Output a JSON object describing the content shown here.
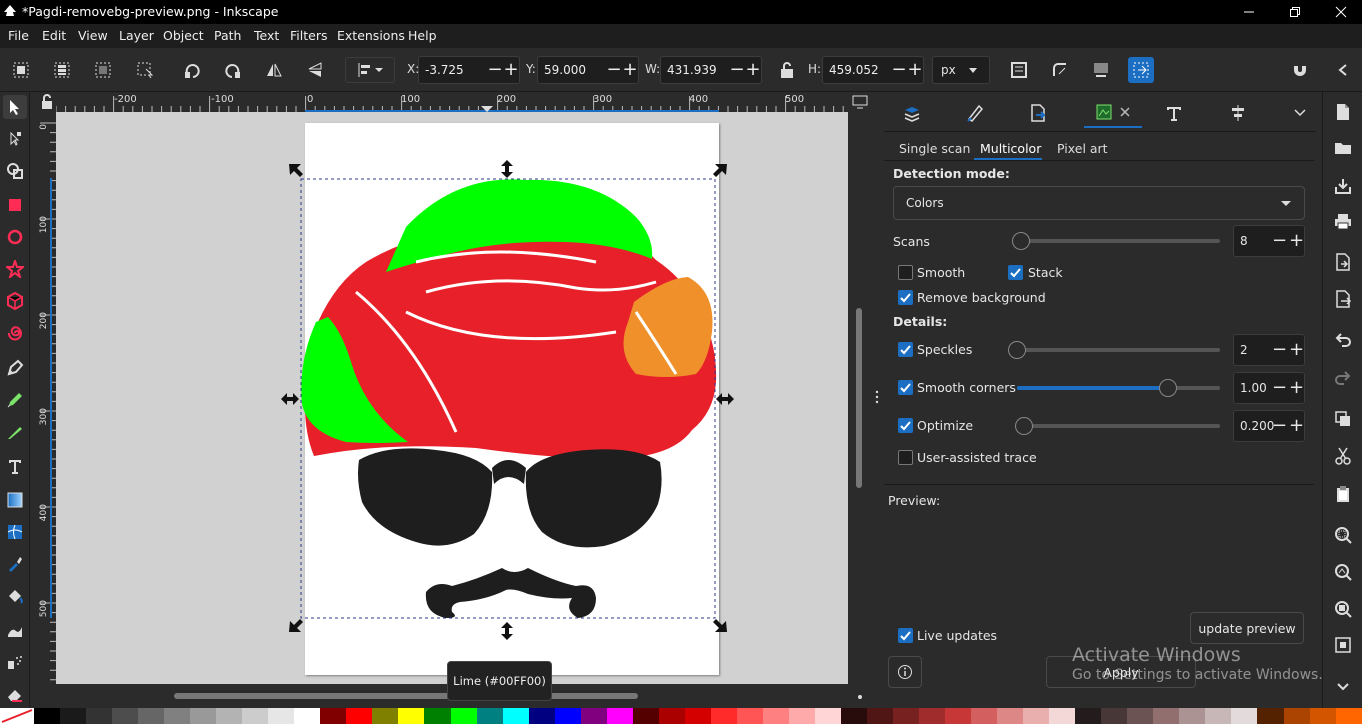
{
  "window": {
    "title": "*Pagdi-removebg-preview.png - Inkscape"
  },
  "menu": [
    "File",
    "Edit",
    "View",
    "Layer",
    "Object",
    "Path",
    "Text",
    "Filters",
    "Extensions",
    "Help"
  ],
  "toolbar": {
    "x_label": "X:",
    "x_value": "-3.725",
    "y_label": "Y:",
    "y_value": "59.000",
    "w_label": "W:",
    "w_value": "431.939",
    "h_label": "H:",
    "h_value": "459.052",
    "unit": "px"
  },
  "rulers": {
    "h_ticks": [
      "-200",
      "-100",
      "0",
      "100",
      "200",
      "300",
      "400",
      "500"
    ],
    "v_ticks": [
      "0",
      "100",
      "200",
      "300",
      "400",
      "500"
    ]
  },
  "trace": {
    "tabs": [
      "Single scan",
      "Multicolor",
      "Pixel art"
    ],
    "active_tab": "Multicolor",
    "detection_mode_label": "Detection mode:",
    "detection_mode_value": "Colors",
    "scans_label": "Scans",
    "scans_value": "8",
    "smooth_label": "Smooth",
    "stack_label": "Stack",
    "remove_bg_label": "Remove background",
    "details_label": "Details:",
    "speckles_label": "Speckles",
    "speckles_value": "2",
    "smooth_corners_label": "Smooth corners",
    "smooth_corners_value": "1.00",
    "optimize_label": "Optimize",
    "optimize_value": "0.200",
    "user_assisted_label": "User-assisted trace",
    "preview_label": "Preview:",
    "live_updates_label": "Live updates",
    "update_preview_label": "update preview",
    "apply_label": "Apply"
  },
  "tooltip": "Lime (#00FF00)",
  "watermark": {
    "line1": "Activate Windows",
    "line2": "Go to Settings to activate Windows."
  },
  "colors": {
    "accent": "#1b6ec2",
    "turban_red": "#e8202a",
    "turban_green": "#00ff00",
    "turban_orange": "#f0902a",
    "black": "#1e1e1e"
  },
  "palette": [
    "#000000",
    "#1a1a1a",
    "#333333",
    "#4d4d4d",
    "#666666",
    "#808080",
    "#999999",
    "#b3b3b3",
    "#cccccc",
    "#e6e6e6",
    "#ffffff",
    "#800000",
    "#ff0000",
    "#808000",
    "#ffff00",
    "#008000",
    "#00ff00",
    "#008080",
    "#00ffff",
    "#000080",
    "#0000ff",
    "#800080",
    "#ff00ff",
    "#550000",
    "#aa0000",
    "#d40000",
    "#ff2a2a",
    "#ff5555",
    "#ff8080",
    "#ffaaaa",
    "#ffd5d5",
    "#280b0b",
    "#501616",
    "#782121",
    "#a02c2c",
    "#c83737",
    "#d35f5f",
    "#de8787",
    "#e9afaf",
    "#f4d7d7",
    "#241c1c",
    "#483737",
    "#6c5353",
    "#916f6f",
    "#ac9393",
    "#c8b7b7",
    "#e3dbdb",
    "#552200",
    "#aa4400",
    "#d45500",
    "#ff6600"
  ]
}
